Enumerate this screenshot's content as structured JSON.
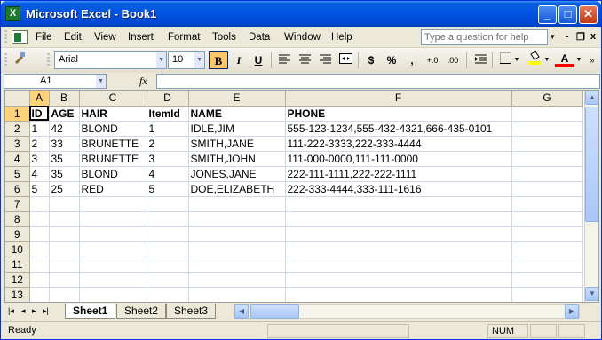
{
  "window": {
    "title": "Microsoft Excel - Book1",
    "app_icon": "X"
  },
  "caption_buttons": {
    "minimize": "_",
    "maximize": "□",
    "close": "✕"
  },
  "menus": [
    "File",
    "Edit",
    "View",
    "Insert",
    "Format",
    "Tools",
    "Data",
    "Window",
    "Help"
  ],
  "help_search": {
    "placeholder": "Type a question for help",
    "dropdown": "▾"
  },
  "doc_controls": {
    "minimize": "-",
    "restore": "❐",
    "close": "x"
  },
  "toolbar": {
    "font_name": "Arial",
    "font_size": "10",
    "bold": "B",
    "italic": "I",
    "underline": "U",
    "currency": "$",
    "percent": "%",
    "comma": ",",
    "increase_decimal": "+.0",
    "decrease_decimal": ".00",
    "font_color": "A"
  },
  "formula_bar": {
    "name_box": "A1",
    "fx": "fx",
    "formula": ""
  },
  "grid": {
    "columns": [
      "A",
      "B",
      "C",
      "D",
      "E",
      "F",
      "G"
    ],
    "rows": [
      [
        "ID",
        "AGE",
        "HAIR",
        "ItemId",
        "NAME",
        "PHONE",
        ""
      ],
      [
        "1",
        "42",
        "BLOND",
        "1",
        "IDLE,JIM",
        "555-123-1234,555-432-4321,666-435-0101",
        ""
      ],
      [
        "2",
        "33",
        "BRUNETTE",
        "2",
        "SMITH,JANE",
        "111-222-3333,222-333-4444",
        ""
      ],
      [
        "3",
        "35",
        "BRUNETTE",
        "3",
        "SMITH,JOHN",
        "111-000-0000,111-111-0000",
        ""
      ],
      [
        "4",
        "35",
        "BLOND",
        "4",
        "JONES,JANE",
        "222-111-1111,222-222-1111",
        ""
      ],
      [
        "5",
        "25",
        "RED",
        "5",
        "DOE,ELIZABETH",
        "222-333-4444,333-111-1616",
        ""
      ],
      [
        "",
        "",
        "",
        "",
        "",
        "",
        ""
      ],
      [
        "",
        "",
        "",
        "",
        "",
        "",
        ""
      ],
      [
        "",
        "",
        "",
        "",
        "",
        "",
        ""
      ],
      [
        "",
        "",
        "",
        "",
        "",
        "",
        ""
      ],
      [
        "",
        "",
        "",
        "",
        "",
        "",
        ""
      ],
      [
        "",
        "",
        "",
        "",
        "",
        "",
        ""
      ],
      [
        "",
        "",
        "",
        "",
        "",
        "",
        ""
      ]
    ]
  },
  "sheets": [
    "Sheet1",
    "Sheet2",
    "Sheet3"
  ],
  "sheet_nav": [
    "|◂",
    "◂",
    "▸",
    "▸|"
  ],
  "status": {
    "ready": "Ready",
    "num": "NUM"
  },
  "colors": {
    "title_blue": "#0054e3",
    "selected_header": "#ffd37a",
    "grid_line": "#d0d7e5"
  }
}
